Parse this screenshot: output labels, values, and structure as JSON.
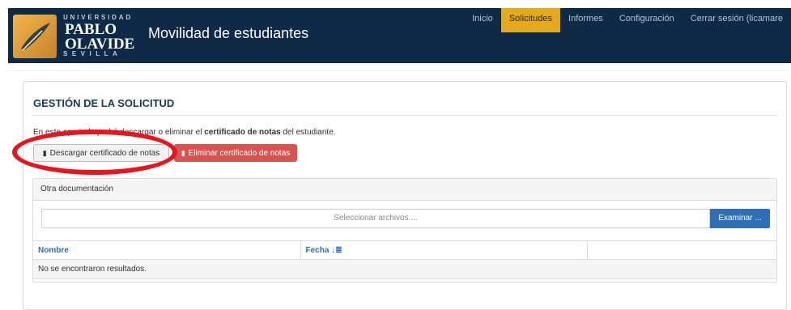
{
  "header": {
    "logo": {
      "line1": "UNIVERSIDAD",
      "line2a": "PABLO",
      "line2b": "OLAVIDE",
      "line3": "SEVILLA"
    },
    "app_title": "Movilidad de estudiantes",
    "nav": [
      {
        "label": "Inicio"
      },
      {
        "label": "Solicitudes"
      },
      {
        "label": "Informes"
      },
      {
        "label": "Configuración"
      },
      {
        "label": "Cerrar sesión (licamare"
      }
    ]
  },
  "panel": {
    "title": "GESTIÓN DE LA SOLICITUD",
    "desc_pre": "En este apartado podrá descargar o eliminar el ",
    "desc_bold": "certificado de notas",
    "desc_post": " del estudiante.",
    "download_label": "Descargar certificado de notas",
    "delete_label": "Eliminar certificado de notas"
  },
  "other_docs": {
    "heading": "Otra documentación",
    "file_placeholder": "Seleccionar archivos ...",
    "browse_label": "Examinar ...",
    "columns": [
      "Nombre",
      "Fecha",
      ""
    ],
    "empty_text": "No se encontraron resultados."
  },
  "colors": {
    "navbar": "#0e2a47",
    "active_tab": "#e5a91e",
    "danger": "#d9534f",
    "primary": "#2e6fb5",
    "highlight_ring": "#e8141e"
  }
}
